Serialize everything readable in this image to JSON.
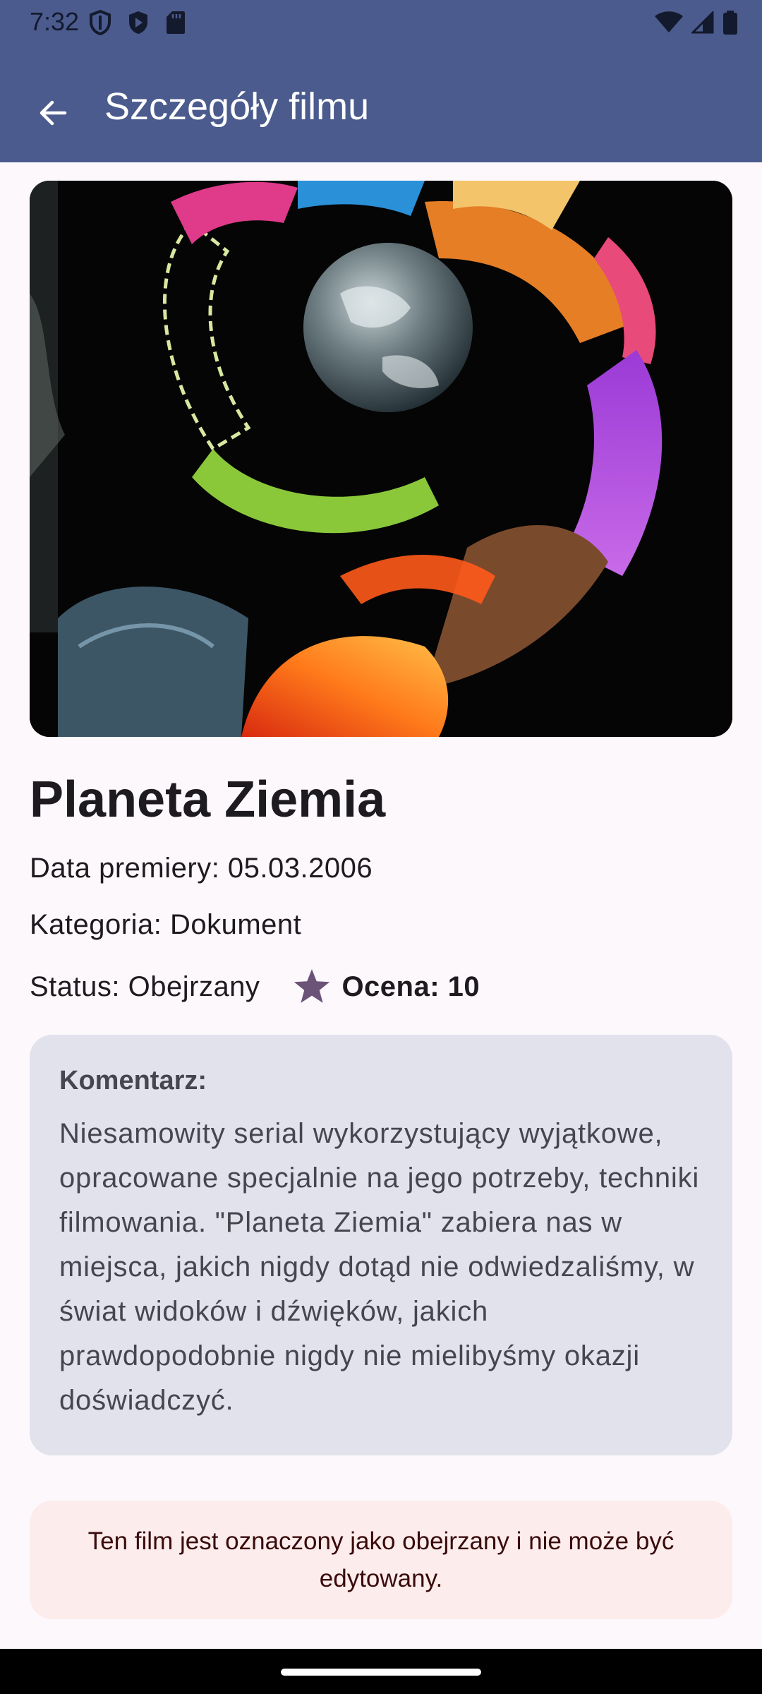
{
  "status_bar": {
    "time": "7:32",
    "icons_left": [
      "shield-icon",
      "play-protect-icon",
      "sd-card-icon"
    ],
    "icons_right": [
      "wifi-icon",
      "signal-icon",
      "battery-icon"
    ]
  },
  "toolbar": {
    "back_icon": "arrow-back-icon",
    "title": "Szczegóły filmu"
  },
  "colors": {
    "app_bar": "#4b5b8e",
    "background": "#fdf8fc",
    "comment_card": "#e2e2ec",
    "notice_bg": "#fdecec",
    "star": "#6b5277"
  },
  "movie": {
    "poster_icon": "movie-poster-image",
    "title": "Planeta Ziemia",
    "release_date": "Data premiery: 05.03.2006",
    "category": "Kategoria: Dokument",
    "status": "Status: Obejrzany",
    "rating_icon": "star-icon",
    "rating": "Ocena: 10"
  },
  "comment": {
    "label": "Komentarz:",
    "text": "Niesamowity serial wykorzystujący wyjątkowe, opracowane specjalnie na jego potrzeby, techniki filmowania. \"Planeta Ziemia\" zabiera nas w miejsca, jakich nigdy dotąd nie odwiedzaliśmy, w świat widoków i dźwięków, jakich prawdopodobnie nigdy nie mielibyśmy okazji doświadczyć."
  },
  "notice": {
    "text": "Ten film jest oznaczony jako obejrzany i nie może być edytowany."
  }
}
